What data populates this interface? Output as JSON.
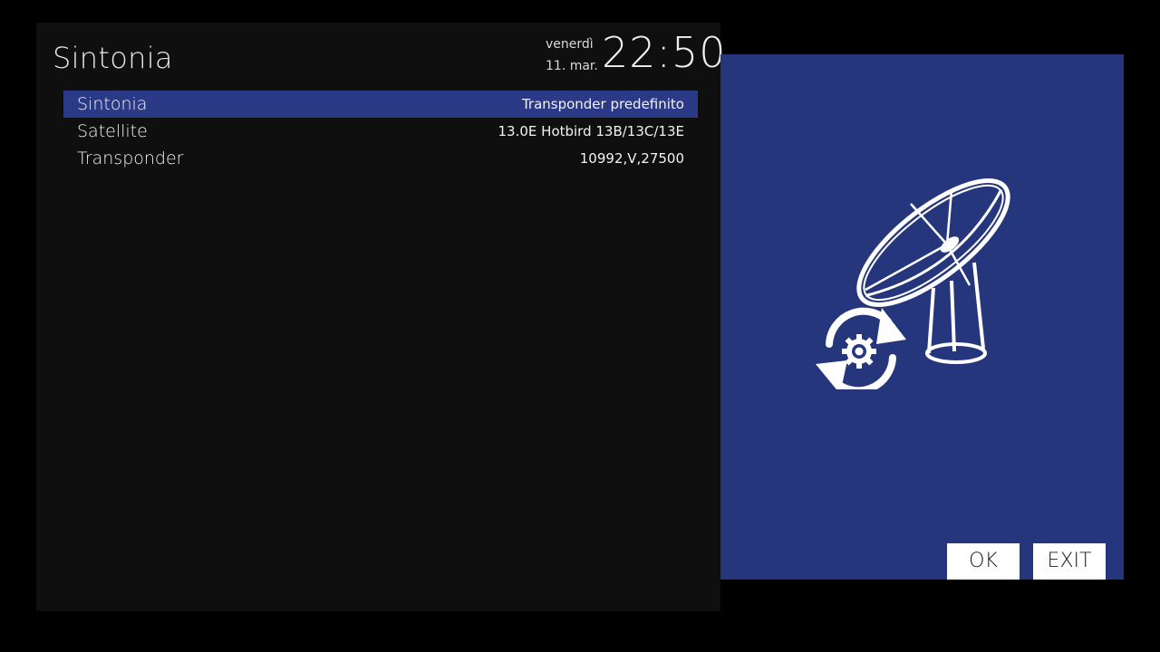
{
  "header": {
    "title": "Sintonia",
    "day": "venerdì",
    "date": "11. mar.",
    "time": "22:50"
  },
  "menu": {
    "items": [
      {
        "label": "Sintonia",
        "value": "Transponder predefinito",
        "selected": true
      },
      {
        "label": "Satellite",
        "value": "13.0E Hotbird 13B/13C/13E",
        "selected": false
      },
      {
        "label": "Transponder",
        "value": "10992,V,27500",
        "selected": false
      }
    ]
  },
  "side_panel": {
    "icon": "satellite-dish-scan-icon",
    "ok_label": "OK",
    "exit_label": "EXIT"
  },
  "colors": {
    "background": "#000000",
    "panel": "#0f0f0f",
    "highlight": "#2a3a86",
    "side_panel": "#26367c",
    "text": "#f2f2f2"
  }
}
